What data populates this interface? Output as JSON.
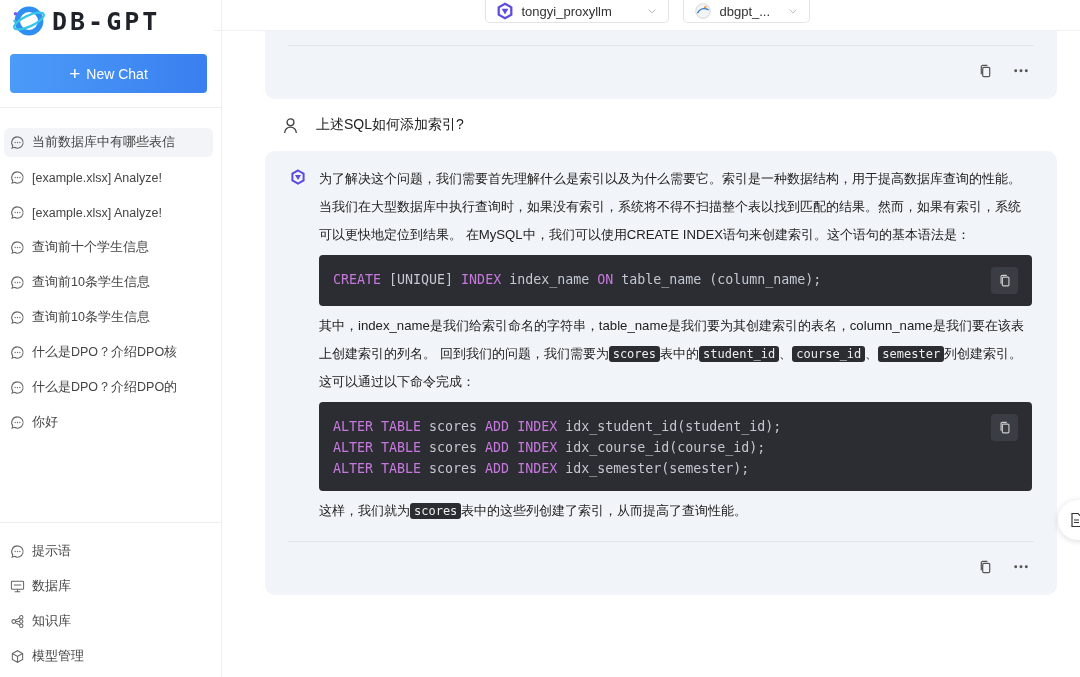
{
  "logo": {
    "text": "DB-GPT"
  },
  "new_chat": {
    "label": "New Chat",
    "icon": "+"
  },
  "history": [
    {
      "label": "当前数据库中有哪些表信",
      "selected": true
    },
    {
      "label": "[example.xlsx] Analyze!",
      "selected": false
    },
    {
      "label": "[example.xlsx] Analyze!",
      "selected": false
    },
    {
      "label": "查询前十个学生信息",
      "selected": false
    },
    {
      "label": "查询前10条学生信息",
      "selected": false
    },
    {
      "label": "查询前10条学生信息",
      "selected": false
    },
    {
      "label": "什么是DPO？介绍DPO核",
      "selected": false
    },
    {
      "label": "什么是DPO？介绍DPO的",
      "selected": false
    },
    {
      "label": "你好",
      "selected": false
    }
  ],
  "nav": [
    {
      "kind": "prompt",
      "label": "提示语"
    },
    {
      "kind": "database",
      "label": "数据库"
    },
    {
      "kind": "knowledge",
      "label": "知识库"
    },
    {
      "kind": "model",
      "label": "模型管理"
    }
  ],
  "selectors": [
    {
      "kind": "model",
      "value": "tongyi_proxyllm"
    },
    {
      "kind": "db",
      "value": "dbgpt_..."
    }
  ],
  "messages": [
    {
      "kind": "assistant",
      "cut": true
    },
    {
      "kind": "user",
      "text": "上述SQL如何添加索引?"
    },
    {
      "kind": "assistant",
      "cut": false,
      "blocks": [
        {
          "kind": "paragraph",
          "segments": [
            {
              "kind": "text",
              "text": "为了解决这个问题，我们需要首先理解什么是索引以及为什么需要它。索引是一种数据结构，用于提高数据库查询的性能。当我们在大型数据库中执行查询时，如果没有索引，系统将不得不扫描整个表以找到匹配的结果。然而，如果有索引，系统可以更快地定位到结果。 在MySQL中，我们可以使用CREATE INDEX语句来创建索引。这个语句的基本语法是："
            }
          ]
        },
        {
          "kind": "code",
          "lines": [
            [
              {
                "kind": "kw",
                "text": "CREATE"
              },
              {
                "kind": "plain",
                "text": " [UNIQUE] "
              },
              {
                "kind": "kw",
                "text": "INDEX"
              },
              {
                "kind": "plain",
                "text": " index_name "
              },
              {
                "kind": "kw",
                "text": "ON"
              },
              {
                "kind": "plain",
                "text": " table_name (column_name);"
              }
            ]
          ]
        },
        {
          "kind": "paragraph",
          "segments": [
            {
              "kind": "text",
              "text": "其中，index_name是我们给索引命名的字符串，table_name是我们要为其创建索引的表名，column_name是我们要在该表上创建索引的列名。 回到我们的问题，我们需要为"
            },
            {
              "kind": "code",
              "text": "scores"
            },
            {
              "kind": "text",
              "text": "表中的"
            },
            {
              "kind": "code",
              "text": "student_id"
            },
            {
              "kind": "text",
              "text": "、"
            },
            {
              "kind": "code",
              "text": "course_id"
            },
            {
              "kind": "text",
              "text": "、"
            },
            {
              "kind": "code",
              "text": "semester"
            },
            {
              "kind": "text",
              "text": "列创建索引。这可以通过以下命令完成："
            }
          ]
        },
        {
          "kind": "code",
          "lines": [
            [
              {
                "kind": "kw",
                "text": "ALTER TABLE"
              },
              {
                "kind": "plain",
                "text": " scores "
              },
              {
                "kind": "kw",
                "text": "ADD INDEX"
              },
              {
                "kind": "plain",
                "text": " idx_student_id(student_id);"
              }
            ],
            [
              {
                "kind": "kw",
                "text": "ALTER TABLE"
              },
              {
                "kind": "plain",
                "text": " scores "
              },
              {
                "kind": "kw",
                "text": "ADD INDEX"
              },
              {
                "kind": "plain",
                "text": " idx_course_id(course_id);"
              }
            ],
            [
              {
                "kind": "kw",
                "text": "ALTER TABLE"
              },
              {
                "kind": "plain",
                "text": " scores "
              },
              {
                "kind": "kw",
                "text": "ADD INDEX"
              },
              {
                "kind": "plain",
                "text": " idx_semester(semester);"
              }
            ]
          ]
        },
        {
          "kind": "paragraph",
          "segments": [
            {
              "kind": "text",
              "text": "这样，我们就为"
            },
            {
              "kind": "code",
              "text": "scores"
            },
            {
              "kind": "text",
              "text": "表中的这些列创建了索引，从而提高了查询性能。"
            }
          ]
        }
      ]
    }
  ]
}
